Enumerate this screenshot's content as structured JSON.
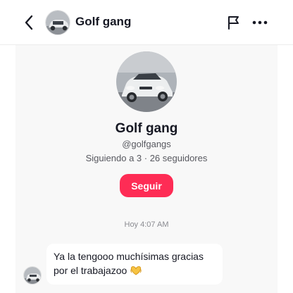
{
  "header": {
    "title": "Golf gang",
    "back_icon": "chevron-left-icon",
    "flag_icon": "flag-icon",
    "more_icon": "more-dots-icon"
  },
  "profile": {
    "name": "Golf gang",
    "handle": "@golfgangs",
    "stats": "Siguiendo a 3 · 26 seguidores",
    "follow_label": "Seguir"
  },
  "conversation": {
    "timestamp": "Hoy 4:07 AM",
    "messages": [
      {
        "line1": "Ya la tengooo muchísimas gracias",
        "line2": "por el trabajazoo",
        "emoji": "🫶"
      }
    ]
  },
  "colors": {
    "accent": "#fe2c55",
    "chat_background": "#f8f8f8",
    "text_primary": "#161823",
    "text_secondary": "#57585f"
  }
}
